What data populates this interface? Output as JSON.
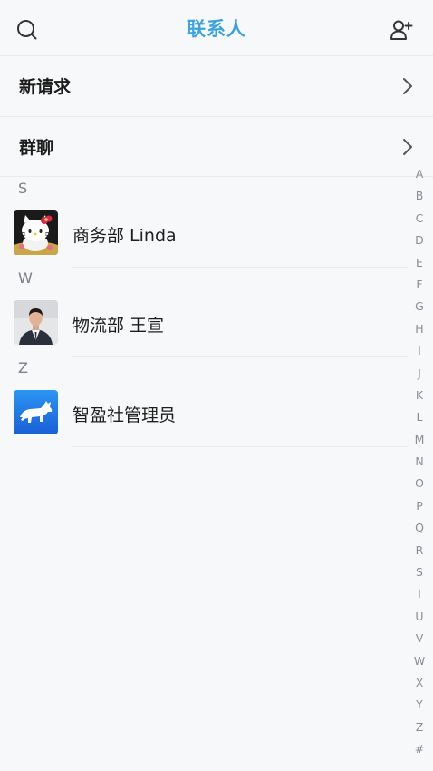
{
  "header": {
    "title": "联系人",
    "search_icon": "search-icon",
    "add_icon": "add-contact-icon"
  },
  "menu": [
    {
      "label": "新请求"
    },
    {
      "label": "群聊"
    }
  ],
  "sections": [
    {
      "letter": "S",
      "contacts": [
        {
          "name": "商务部 Linda",
          "avatar": "hello-kitty-avatar"
        }
      ]
    },
    {
      "letter": "W",
      "contacts": [
        {
          "name": "物流部 王宣",
          "avatar": "person-photo-avatar"
        }
      ]
    },
    {
      "letter": "Z",
      "contacts": [
        {
          "name": "智盈社管理员",
          "avatar": "bull-logo-avatar"
        }
      ]
    }
  ],
  "index_letters": [
    "A",
    "B",
    "C",
    "D",
    "E",
    "F",
    "G",
    "H",
    "I",
    "J",
    "K",
    "L",
    "M",
    "N",
    "O",
    "P",
    "Q",
    "R",
    "S",
    "T",
    "U",
    "V",
    "W",
    "X",
    "Y",
    "Z",
    "#"
  ],
  "colors": {
    "accent": "#3aa3e0",
    "background": "#f7f8f9",
    "bull_logo_blue": "#1f7fea"
  }
}
